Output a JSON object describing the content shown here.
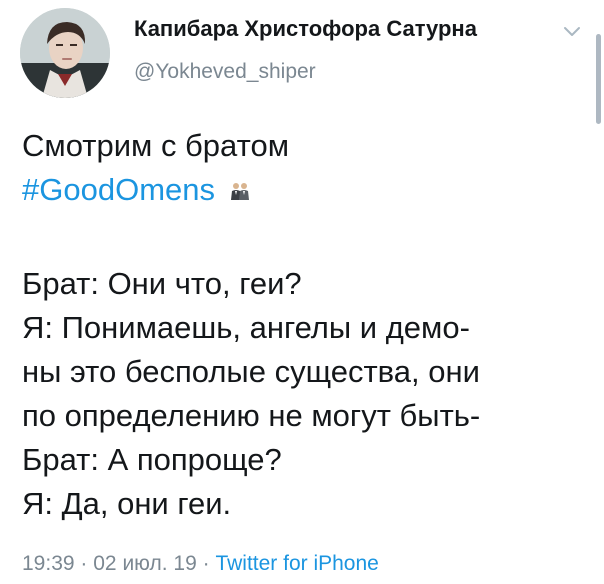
{
  "author": {
    "display_name": "Капибара Христофора Сатурна",
    "handle": "@Yokheved_shiper"
  },
  "tweet": {
    "line1": "Смотрим с братом",
    "hashtag": "#GoodOmens",
    "emoji_icon": "two-men-in-suits-icon",
    "lines": [
      "Брат: Они что, геи?",
      "Я: Понимаешь, ангелы и демо-",
      "ны это бесполые существа, они",
      "по определению не могут быть-",
      "Брат: А попроще?",
      "Я: Да, они геи."
    ]
  },
  "meta": {
    "time": "19:39",
    "separator": "·",
    "date": "02 июл. 19",
    "source": "Twitter for iPhone"
  },
  "colors": {
    "link": "#1b95e0",
    "secondary_text": "#7b8791",
    "primary_text": "#14171a"
  }
}
